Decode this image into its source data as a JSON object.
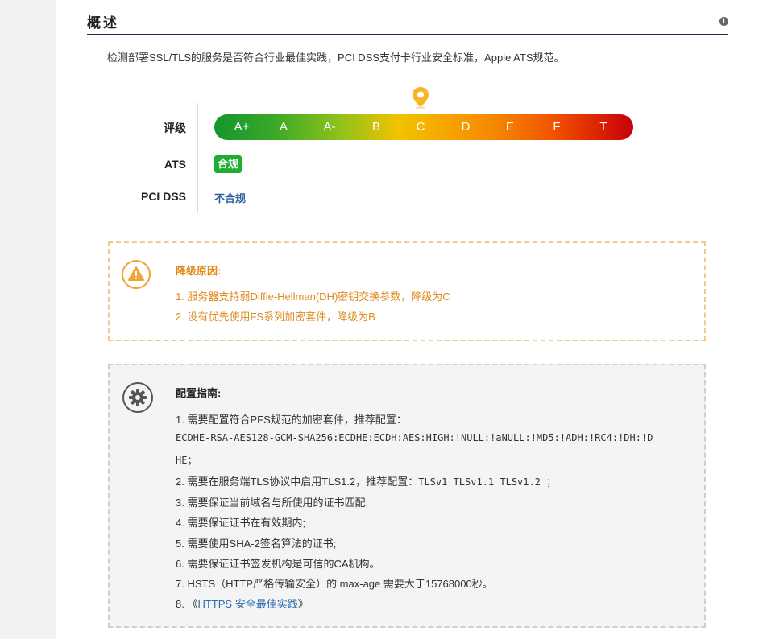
{
  "section": {
    "title": "概述"
  },
  "description": "检测部署SSL/TLS的服务是否符合行业最佳实践，PCI DSS支付卡行业安全标准，Apple ATS规范。",
  "rating": {
    "label": "评级",
    "grades": [
      "A+",
      "A",
      "A-",
      "B",
      "C",
      "D",
      "E",
      "F",
      "T"
    ],
    "current": "C"
  },
  "ats": {
    "label": "ATS",
    "status": "合规",
    "status_color": "#1eae33"
  },
  "pci": {
    "label": "PCI DSS",
    "status": "不合规"
  },
  "downgrade": {
    "title": "降级原因:",
    "items": [
      "1. 服务器支持弱Diffie-Hellman(DH)密钥交换参数，降级为C",
      "2. 没有优先使用FS系列加密套件，降级为B"
    ],
    "icon": "warning-icon"
  },
  "config": {
    "title": "配置指南:",
    "icon": "gear-icon",
    "item1": "1. 需要配置符合PFS规范的加密套件，推荐配置：",
    "cipher_line1": "ECDHE-RSA-AES128-GCM-SHA256:ECDHE:ECDH:AES:HIGH:!NULL:!aNULL:!MD5:!ADH:!RC4:!DH:!D",
    "cipher_line2": "HE；",
    "item2_prefix": "2. 需要在服务端TLS协议中启用TLS1.2，推荐配置：",
    "item2_code": "TLSv1 TLSv1.1 TLSv1.2 ；",
    "item3": "3. 需要保证当前域名与所使用的证书匹配;",
    "item4": "4. 需要保证证书在有效期内;",
    "item5": "5. 需要使用SHA-2签名算法的证书;",
    "item6": "6. 需要保证证书签发机构是可信的CA机构。",
    "item7": "7. HSTS（HTTP严格传输安全）的 max-age 需要大于15768000秒。",
    "item8_prefix": "8. 《",
    "item8_link": "HTTPS 安全最佳实践",
    "item8_suffix": "》"
  }
}
